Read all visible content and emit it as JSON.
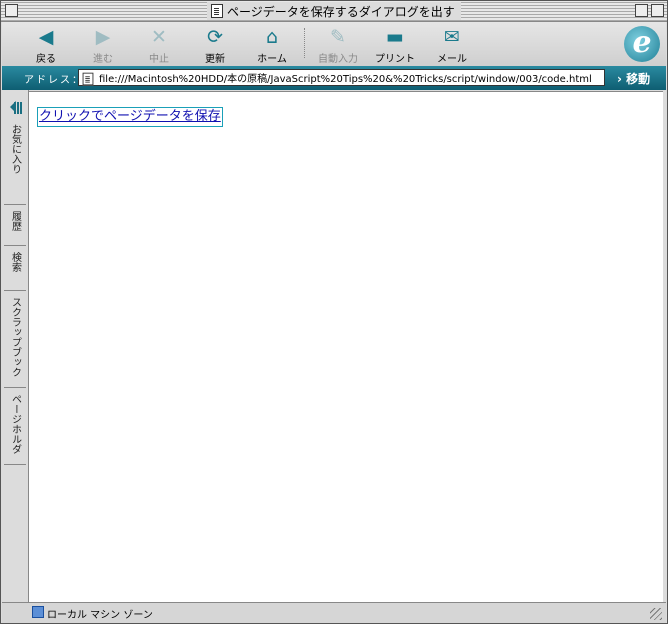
{
  "window": {
    "title": "ページデータを保存するダイアログを出す"
  },
  "toolbar": {
    "back": "戻る",
    "forward": "進む",
    "stop": "中止",
    "refresh": "更新",
    "home": "ホーム",
    "autofill": "自動入力",
    "print": "プリント",
    "mail": "メール"
  },
  "addressbar": {
    "label": "アドレス：",
    "url": "file:///Macintosh%20HDD/本の原稿/JavaScript%20Tips%20&%20Tricks/script/window/003/code.html",
    "go": "移動"
  },
  "explorer_tabs": [
    "お気に入り",
    "履歴",
    "検索",
    "スクラップブック",
    "ページホルダ"
  ],
  "content": {
    "save_link": "クリックでページデータを保存"
  },
  "status": {
    "zone": "ローカル マシン ゾーン"
  },
  "colors": {
    "accent": "#1a7a8c",
    "link": "#1010b0",
    "address_bar": "#0e5e72"
  }
}
